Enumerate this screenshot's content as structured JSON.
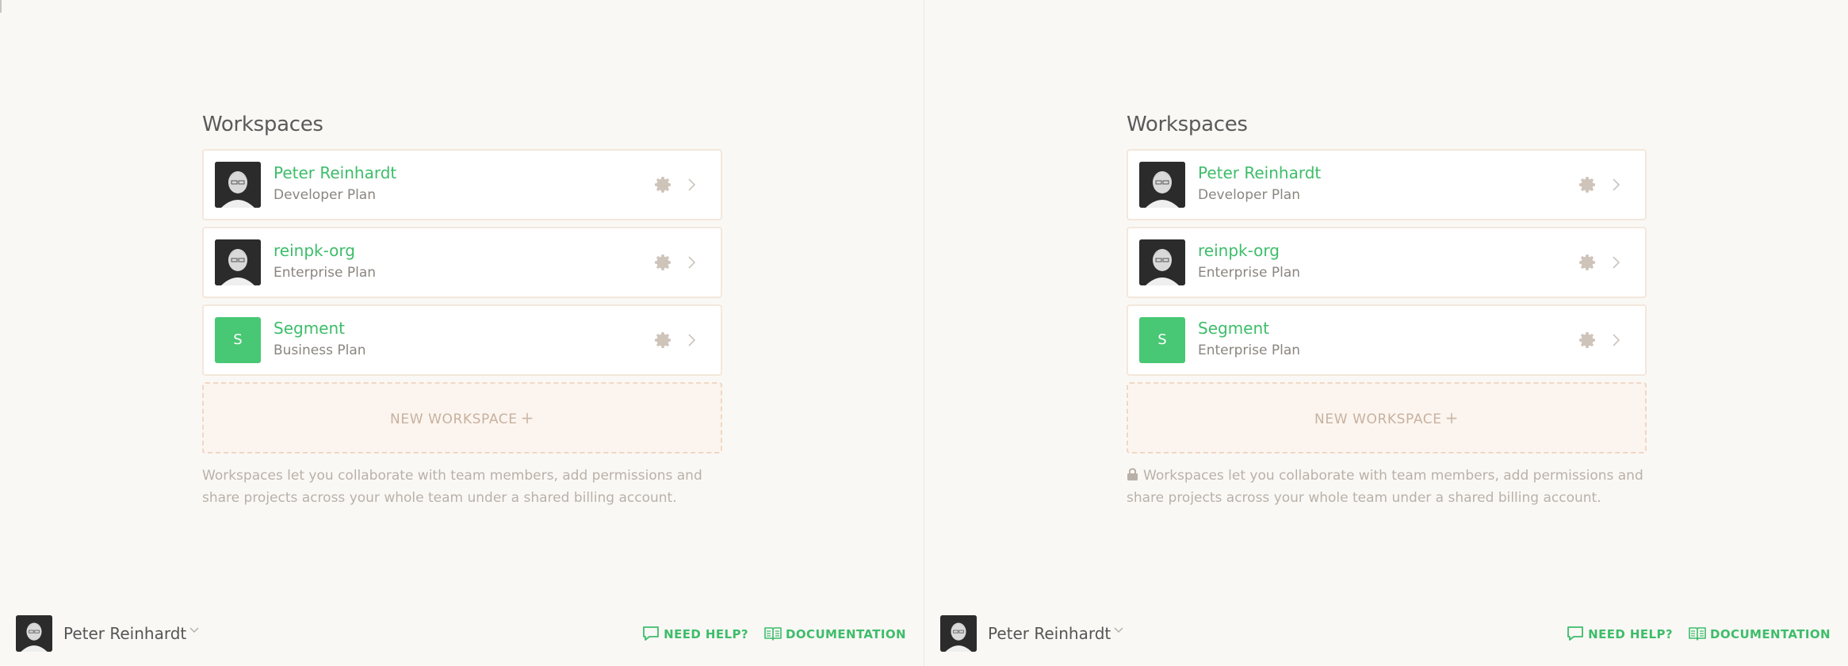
{
  "colors": {
    "background": "#faf8f5",
    "brand_green": "#3dbd6a",
    "card_border": "#f3e7dc",
    "avatar_green": "#48c774",
    "muted_text": "#b9b1a8"
  },
  "panels": [
    {
      "section_title": "Workspaces",
      "workspaces": [
        {
          "name": "Peter Reinhardt",
          "plan": "Developer Plan",
          "avatar": "photo",
          "settings_icon": "gear-icon",
          "open_icon": "chevron-right-icon"
        },
        {
          "name": "reinpk-org",
          "plan": "Enterprise Plan",
          "avatar": "photo",
          "settings_icon": "gear-icon",
          "open_icon": "chevron-right-icon"
        },
        {
          "name": "Segment",
          "plan": "Business Plan",
          "avatar": "letter",
          "avatar_letter": "S",
          "settings_icon": "gear-icon",
          "open_icon": "chevron-right-icon"
        }
      ],
      "new_workspace_label": "NEW WORKSPACE",
      "new_workspace_icon": "+",
      "help_text": "Workspaces let you collaborate with team members, add permissions and share projects across your whole team under a shared billing account.",
      "show_lock_icon": false,
      "footer": {
        "user_name": "Peter Reinhardt",
        "need_help_label": "NEED HELP?",
        "documentation_label": "DOCUMENTATION"
      }
    },
    {
      "section_title": "Workspaces",
      "workspaces": [
        {
          "name": "Peter Reinhardt",
          "plan": "Developer Plan",
          "avatar": "photo",
          "settings_icon": "gear-icon",
          "open_icon": "chevron-right-icon"
        },
        {
          "name": "reinpk-org",
          "plan": "Enterprise Plan",
          "avatar": "photo",
          "settings_icon": "gear-icon",
          "open_icon": "chevron-right-icon"
        },
        {
          "name": "Segment",
          "plan": "Enterprise Plan",
          "avatar": "letter",
          "avatar_letter": "S",
          "settings_icon": "gear-icon",
          "open_icon": "chevron-right-icon"
        }
      ],
      "new_workspace_label": "NEW WORKSPACE",
      "new_workspace_icon": "+",
      "help_text": "Workspaces let you collaborate with team members, add permissions and share projects across your whole team under a shared billing account.",
      "show_lock_icon": true,
      "footer": {
        "user_name": "Peter Reinhardt",
        "need_help_label": "NEED HELP?",
        "documentation_label": "DOCUMENTATION"
      }
    }
  ]
}
